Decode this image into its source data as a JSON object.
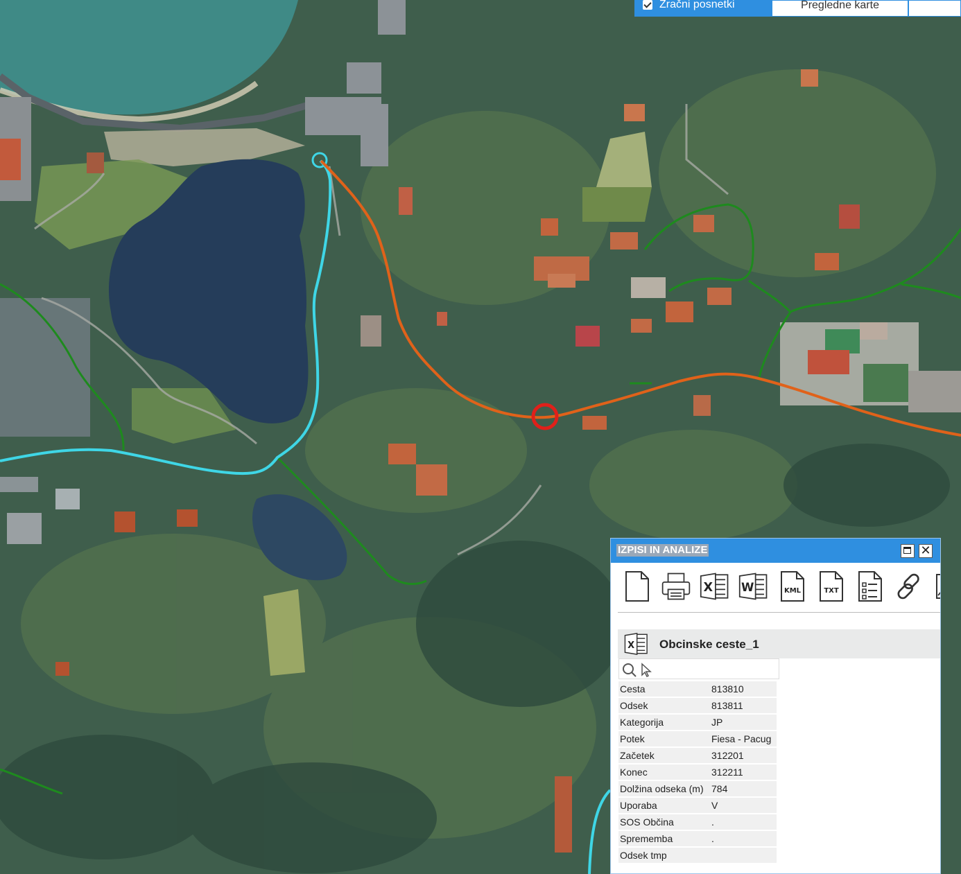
{
  "layer_tabs": [
    {
      "label": "Zračni posnetki",
      "checked": true,
      "active": true
    },
    {
      "label": "Pregledne karte",
      "active": false
    }
  ],
  "panel": {
    "title": "IZPISI IN ANALIZE",
    "tools": [
      "new-document-icon",
      "print-icon",
      "excel-icon",
      "word-icon",
      "kml-icon",
      "txt-icon",
      "list-icon",
      "link-icon",
      "image-icon"
    ],
    "tool_badges": {
      "kml": "KML",
      "txt": "TXT",
      "excel": "X",
      "word": "W"
    },
    "layer_name": "Obcinske ceste_1",
    "attributes": [
      {
        "key": "Cesta",
        "value": "813810"
      },
      {
        "key": "Odsek",
        "value": "813811"
      },
      {
        "key": "Kategorija",
        "value": "JP"
      },
      {
        "key": "Potek",
        "value": "Fiesa - Pacug"
      },
      {
        "key": "Začetek",
        "value": "312201"
      },
      {
        "key": "Konec",
        "value": "312211"
      },
      {
        "key": "Dolžina odseka (m)",
        "value": "784"
      },
      {
        "key": "Uporaba",
        "value": "V"
      },
      {
        "key": "SOS Občina",
        "value": "."
      },
      {
        "key": "Sprememba",
        "value": "."
      },
      {
        "key": "Odsek tmp",
        "value": ""
      }
    ]
  },
  "colors": {
    "panel_header": "#2f8fe0",
    "selected_road": "#e0621a",
    "cyan_road": "#3fd6e6",
    "green_road": "#1e8a1e",
    "marker": "#e0201a"
  }
}
